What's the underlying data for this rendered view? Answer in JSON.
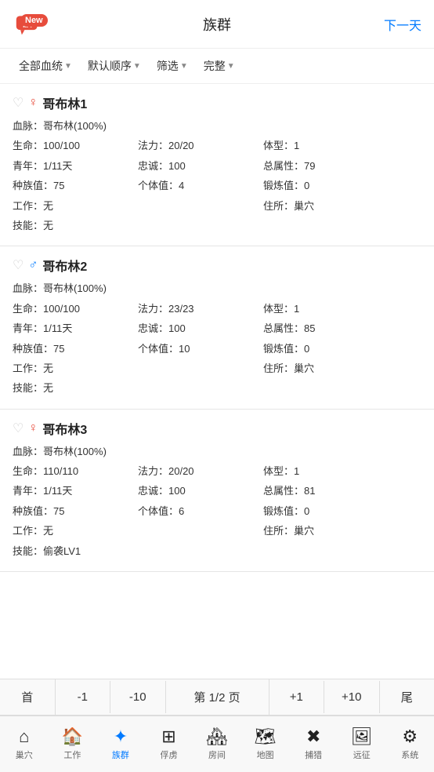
{
  "header": {
    "new_badge": "New",
    "title": "族群",
    "next_btn": "下一天"
  },
  "filter_bar": {
    "items": [
      {
        "label": "全部血统",
        "arrow": "▼"
      },
      {
        "label": "默认顺序",
        "arrow": "▼"
      },
      {
        "label": "筛选",
        "arrow": "▼"
      },
      {
        "label": "完整",
        "arrow": "▼"
      }
    ]
  },
  "creatures": [
    {
      "heart": "♡",
      "gender": "♀",
      "gender_type": "female",
      "name": "哥布林1",
      "bloodline": "血脉：哥布林(100%)",
      "hp": "生命：100/100",
      "mp": "法力：20/20",
      "body": "体型：1",
      "youth": "青年：1/11天",
      "loyalty": "忠诚：100",
      "total_attr": "总属性：79",
      "tribe_val": "种族值：75",
      "individual_val": "个体值：4",
      "forge_val": "锻炼值：0",
      "work": "工作：无",
      "home": "住所：巢穴",
      "skill": "技能：无"
    },
    {
      "heart": "♡",
      "gender": "♂",
      "gender_type": "male",
      "name": "哥布林2",
      "bloodline": "血脉：哥布林(100%)",
      "hp": "生命：100/100",
      "mp": "法力：23/23",
      "body": "体型：1",
      "youth": "青年：1/11天",
      "loyalty": "忠诚：100",
      "total_attr": "总属性：85",
      "tribe_val": "种族值：75",
      "individual_val": "个体值：10",
      "forge_val": "锻炼值：0",
      "work": "工作：无",
      "home": "住所：巢穴",
      "skill": "技能：无"
    },
    {
      "heart": "♡",
      "gender": "♀",
      "gender_type": "female",
      "name": "哥布林3",
      "bloodline": "血脉：哥布林(100%)",
      "hp": "生命：110/110",
      "mp": "法力：20/20",
      "body": "体型：1",
      "youth": "青年：1/11天",
      "loyalty": "忠诚：100",
      "total_attr": "总属性：81",
      "tribe_val": "种族值：75",
      "individual_val": "个体值：6",
      "forge_val": "锻炼值：0",
      "work": "工作：无",
      "home": "住所：巢穴",
      "skill": "技能：偷袭LV1"
    }
  ],
  "pagination": {
    "first": "首",
    "prev1": "-1",
    "prev10": "-10",
    "page_info": "第 1/2 页",
    "next1": "+1",
    "next10": "+10",
    "last": "尾"
  },
  "bottom_nav": {
    "items": [
      {
        "label": "巢穴",
        "icon": "⌂",
        "active": false
      },
      {
        "label": "工作",
        "icon": "🏠",
        "active": false
      },
      {
        "label": "族群",
        "icon": "👥",
        "active": true
      },
      {
        "label": "俘虏",
        "icon": "⊞",
        "active": false
      },
      {
        "label": "房间",
        "icon": "🏘",
        "active": false
      },
      {
        "label": "地图",
        "icon": "🗺",
        "active": false
      },
      {
        "label": "捕猎",
        "icon": "✖",
        "active": false
      },
      {
        "label": "远征",
        "icon": "🖼",
        "active": false
      },
      {
        "label": "系统",
        "icon": "⚙",
        "active": false
      }
    ]
  }
}
